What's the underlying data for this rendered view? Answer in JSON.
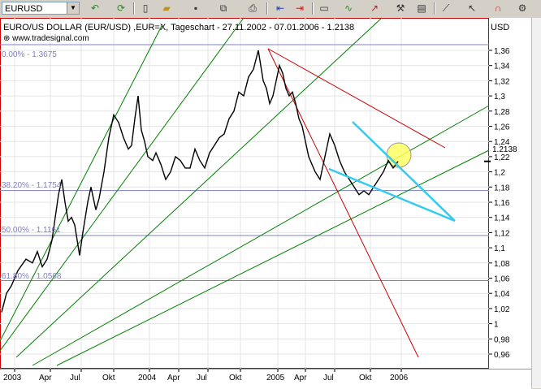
{
  "toolbar": {
    "symbol": "EURUSD",
    "buttons": [
      "undo-icon",
      "refresh-icon",
      "new-icon",
      "open-icon",
      "save-icon",
      "copy-icon",
      "print-icon",
      "chart-left-icon",
      "chart-right-icon",
      "chart-window-icon",
      "indicator-icon",
      "drawing-icon",
      "tools-icon",
      "properties-icon",
      "crosshair-icon",
      "pointer-icon",
      "magnet-icon",
      "settings-icon"
    ]
  },
  "header": {
    "title": "EURO/US DOLLAR (EUR/USD) ,EUR=X, Tageschart - 27.11.2002 - 07.01.2006 - 1.2138",
    "source": "www.tradesignal.com",
    "currency": "USD",
    "current_price": "1.2138"
  },
  "fibonacci": [
    {
      "label": "0.00% - 1.3675",
      "value": 1.3675
    },
    {
      "label": "38.20% - 1.1754",
      "value": 1.1754
    },
    {
      "label": "50.00% - 1.1161",
      "value": 1.1161
    },
    {
      "label": "61.80% - 1.0568",
      "value": 1.0568
    }
  ],
  "chart_data": {
    "type": "line",
    "title": "EURO/US DOLLAR (EUR/USD) ,EUR=X, Tageschart - 27.11.2002 - 07.01.2006 - 1.2138",
    "ylim": [
      0.955,
      1.375
    ],
    "y_ticks": [
      "1,36",
      "1,34",
      "1,32",
      "1,3",
      "1,28",
      "1,26",
      "1,24",
      "1,22",
      "1,2",
      "1,18",
      "1,16",
      "1,14",
      "1,12",
      "1,1",
      "1,08",
      "1,06",
      "1,04",
      "1,02",
      "1",
      "0,98",
      "0,96"
    ],
    "x_ticks": [
      "2003",
      "Apr",
      "Jul",
      "Okt",
      "2004",
      "Apr",
      "Jul",
      "Okt",
      "2005",
      "Apr",
      "Jul",
      "Okt",
      "2006"
    ],
    "x": [
      0,
      6,
      12,
      20,
      30,
      38,
      44,
      50,
      56,
      62,
      66,
      70,
      74,
      78,
      82,
      86,
      90,
      96,
      100,
      106,
      110,
      116,
      120,
      126,
      132,
      138,
      144,
      150,
      156,
      160,
      164,
      168,
      172,
      176,
      180,
      186,
      190,
      196,
      202,
      208,
      214,
      220,
      226,
      232,
      238,
      244,
      250,
      256,
      262,
      268,
      274,
      280,
      286,
      292,
      298,
      304,
      310,
      316,
      322,
      326,
      330,
      334,
      338,
      342,
      346,
      350,
      354,
      358,
      362,
      366,
      370,
      374,
      378,
      382,
      386,
      392,
      398,
      404,
      410,
      416,
      422,
      428,
      434,
      440,
      446,
      452,
      458,
      464,
      470,
      476,
      482,
      488
    ],
    "y": [
      1.015,
      1.04,
      1.05,
      1.07,
      1.085,
      1.08,
      1.095,
      1.075,
      1.085,
      1.11,
      1.14,
      1.17,
      1.19,
      1.16,
      1.135,
      1.14,
      1.13,
      1.09,
      1.12,
      1.16,
      1.18,
      1.15,
      1.165,
      1.2,
      1.245,
      1.275,
      1.265,
      1.245,
      1.23,
      1.235,
      1.27,
      1.3,
      1.255,
      1.24,
      1.22,
      1.215,
      1.225,
      1.21,
      1.19,
      1.2,
      1.22,
      1.215,
      1.205,
      1.205,
      1.23,
      1.215,
      1.205,
      1.225,
      1.235,
      1.245,
      1.25,
      1.27,
      1.28,
      1.305,
      1.3,
      1.325,
      1.335,
      1.36,
      1.32,
      1.31,
      1.29,
      1.3,
      1.32,
      1.34,
      1.33,
      1.31,
      1.3,
      1.305,
      1.29,
      1.27,
      1.26,
      1.24,
      1.22,
      1.21,
      1.2,
      1.19,
      1.22,
      1.25,
      1.235,
      1.215,
      1.2,
      1.19,
      1.18,
      1.17,
      1.175,
      1.17,
      1.18,
      1.19,
      1.2,
      1.215,
      1.205,
      1.2138
    ]
  },
  "colors": {
    "price": "#000000",
    "trend_green": "#008000",
    "trend_red": "#cc0000",
    "channel_cyan": "#33ccee",
    "fib": "#8080c0",
    "highlight": "#ffff66"
  }
}
